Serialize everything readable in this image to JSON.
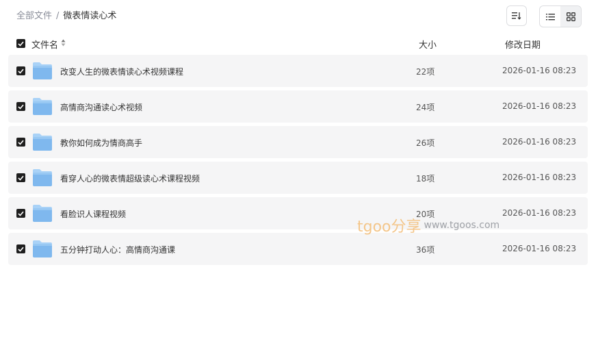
{
  "breadcrumb": {
    "root": "全部文件",
    "separator": "/",
    "current": "微表情读心术"
  },
  "toolbar": {
    "sort_icon": "sort-icon",
    "list_view_icon": "list-view-icon",
    "grid_view_icon": "grid-view-icon",
    "selected_view": "grid"
  },
  "table": {
    "headers": {
      "name": "文件名",
      "size": "大小",
      "date": "修改日期"
    },
    "rows": [
      {
        "name": "改变人生的微表情读心术视频课程",
        "size": "22项",
        "date": "2026-01-16 08:23",
        "checked": true
      },
      {
        "name": "高情商沟通读心术视频",
        "size": "24项",
        "date": "2026-01-16 08:23",
        "checked": true
      },
      {
        "name": "教你如何成为情商高手",
        "size": "26项",
        "date": "2026-01-16 08:23",
        "checked": true
      },
      {
        "name": "看穿人心的微表情超级读心术课程视频",
        "size": "18项",
        "date": "2026-01-16 08:23",
        "checked": true
      },
      {
        "name": "看脸识人课程视频",
        "size": "20项",
        "date": "2026-01-16 08:23",
        "checked": true
      },
      {
        "name": "五分钟打动人心：高情商沟通课",
        "size": "36项",
        "date": "2026-01-16 08:23",
        "checked": true
      }
    ]
  },
  "watermark": {
    "brand": "tgoo分享",
    "url": "www.tgoos.com"
  },
  "colors": {
    "row_bg": "#f5f5f6",
    "checkbox": "#1f1f1f",
    "folder_light": "#a9d2f7",
    "folder_main": "#7fb8ee",
    "watermark_brand": "#f4c68a"
  }
}
